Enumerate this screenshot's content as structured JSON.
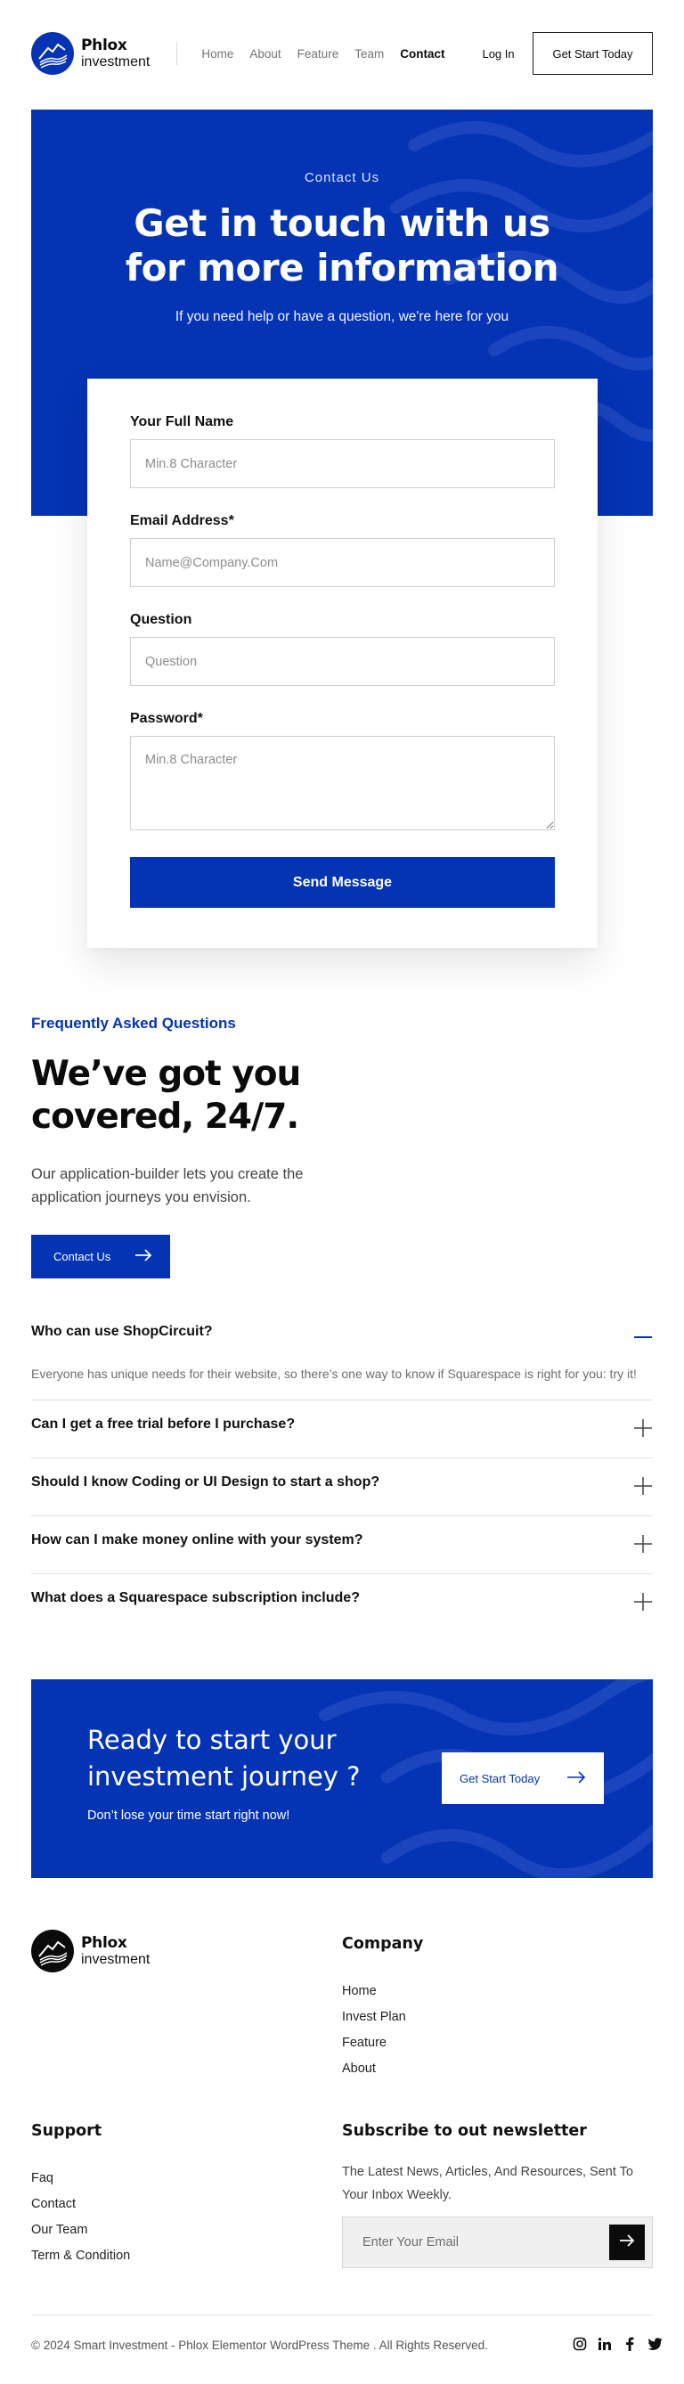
{
  "brand": {
    "name": "Phlox",
    "tagline": "investment"
  },
  "nav": {
    "items": [
      "Home",
      "About",
      "Feature",
      "Team",
      "Contact"
    ],
    "active": "Contact",
    "login": "Log In",
    "cta": "Get Start Today"
  },
  "hero": {
    "eyebrow": "Contact Us",
    "title_line1": "Get in touch with us",
    "title_line2": "for more information",
    "lead": "If you need help or have a question, we're here for you"
  },
  "form": {
    "name_label": "Your Full Name",
    "name_placeholder": "Min.8 Character",
    "email_label": "Email Address*",
    "email_placeholder": "Name@Company.Com",
    "question_label": "Question",
    "question_placeholder": "Question",
    "password_label": "Password*",
    "password_placeholder": "Min.8 Character",
    "submit": "Send Message"
  },
  "faq": {
    "eyebrow": "Frequently Asked Questions",
    "title_line1": "We’ve got you",
    "title_line2": "covered, 24/7.",
    "lead": "Our application-builder lets you create the application journeys you envision.",
    "button": "Contact Us",
    "items": [
      {
        "q": "Who can use ShopCircuit?",
        "a": "Everyone has unique needs for their website, so there’s one way to know if Squarespace is right for you: try it!",
        "open": true
      },
      {
        "q": "Can I get a free trial before I purchase?",
        "open": false
      },
      {
        "q": "Should I know Coding or UI Design to start a shop?",
        "open": false
      },
      {
        "q": "How can I make money online with your system?",
        "open": false
      },
      {
        "q": "What does a Squarespace subscription include?",
        "open": false
      }
    ]
  },
  "cta": {
    "title_line1": "Ready to start your",
    "title_line2": "investment journey ?",
    "sub": "Don’t lose your time start right now!",
    "button": "Get Start Today"
  },
  "footer": {
    "company_title": "Company",
    "company_links": [
      "Home",
      "Invest Plan",
      "Feature",
      "About"
    ],
    "support_title": "Support",
    "support_links": [
      "Faq",
      "Contact",
      "Our Team",
      "Term & Condition"
    ],
    "newsletter_title": "Subscribe to out newsletter",
    "newsletter_text": "The Latest News, Articles, And Resources, Sent To Your Inbox Weekly.",
    "newsletter_placeholder": "Enter Your Email",
    "copyright": "© 2024 Smart Investment - Phlox Elementor WordPress Theme . All Rights Reserved.",
    "socials": [
      "instagram-icon",
      "linkedin-icon",
      "facebook-icon",
      "twitter-icon"
    ]
  },
  "colors": {
    "primary": "#0433b4",
    "text": "#0b0b0b",
    "muted": "#6d6d6d"
  }
}
